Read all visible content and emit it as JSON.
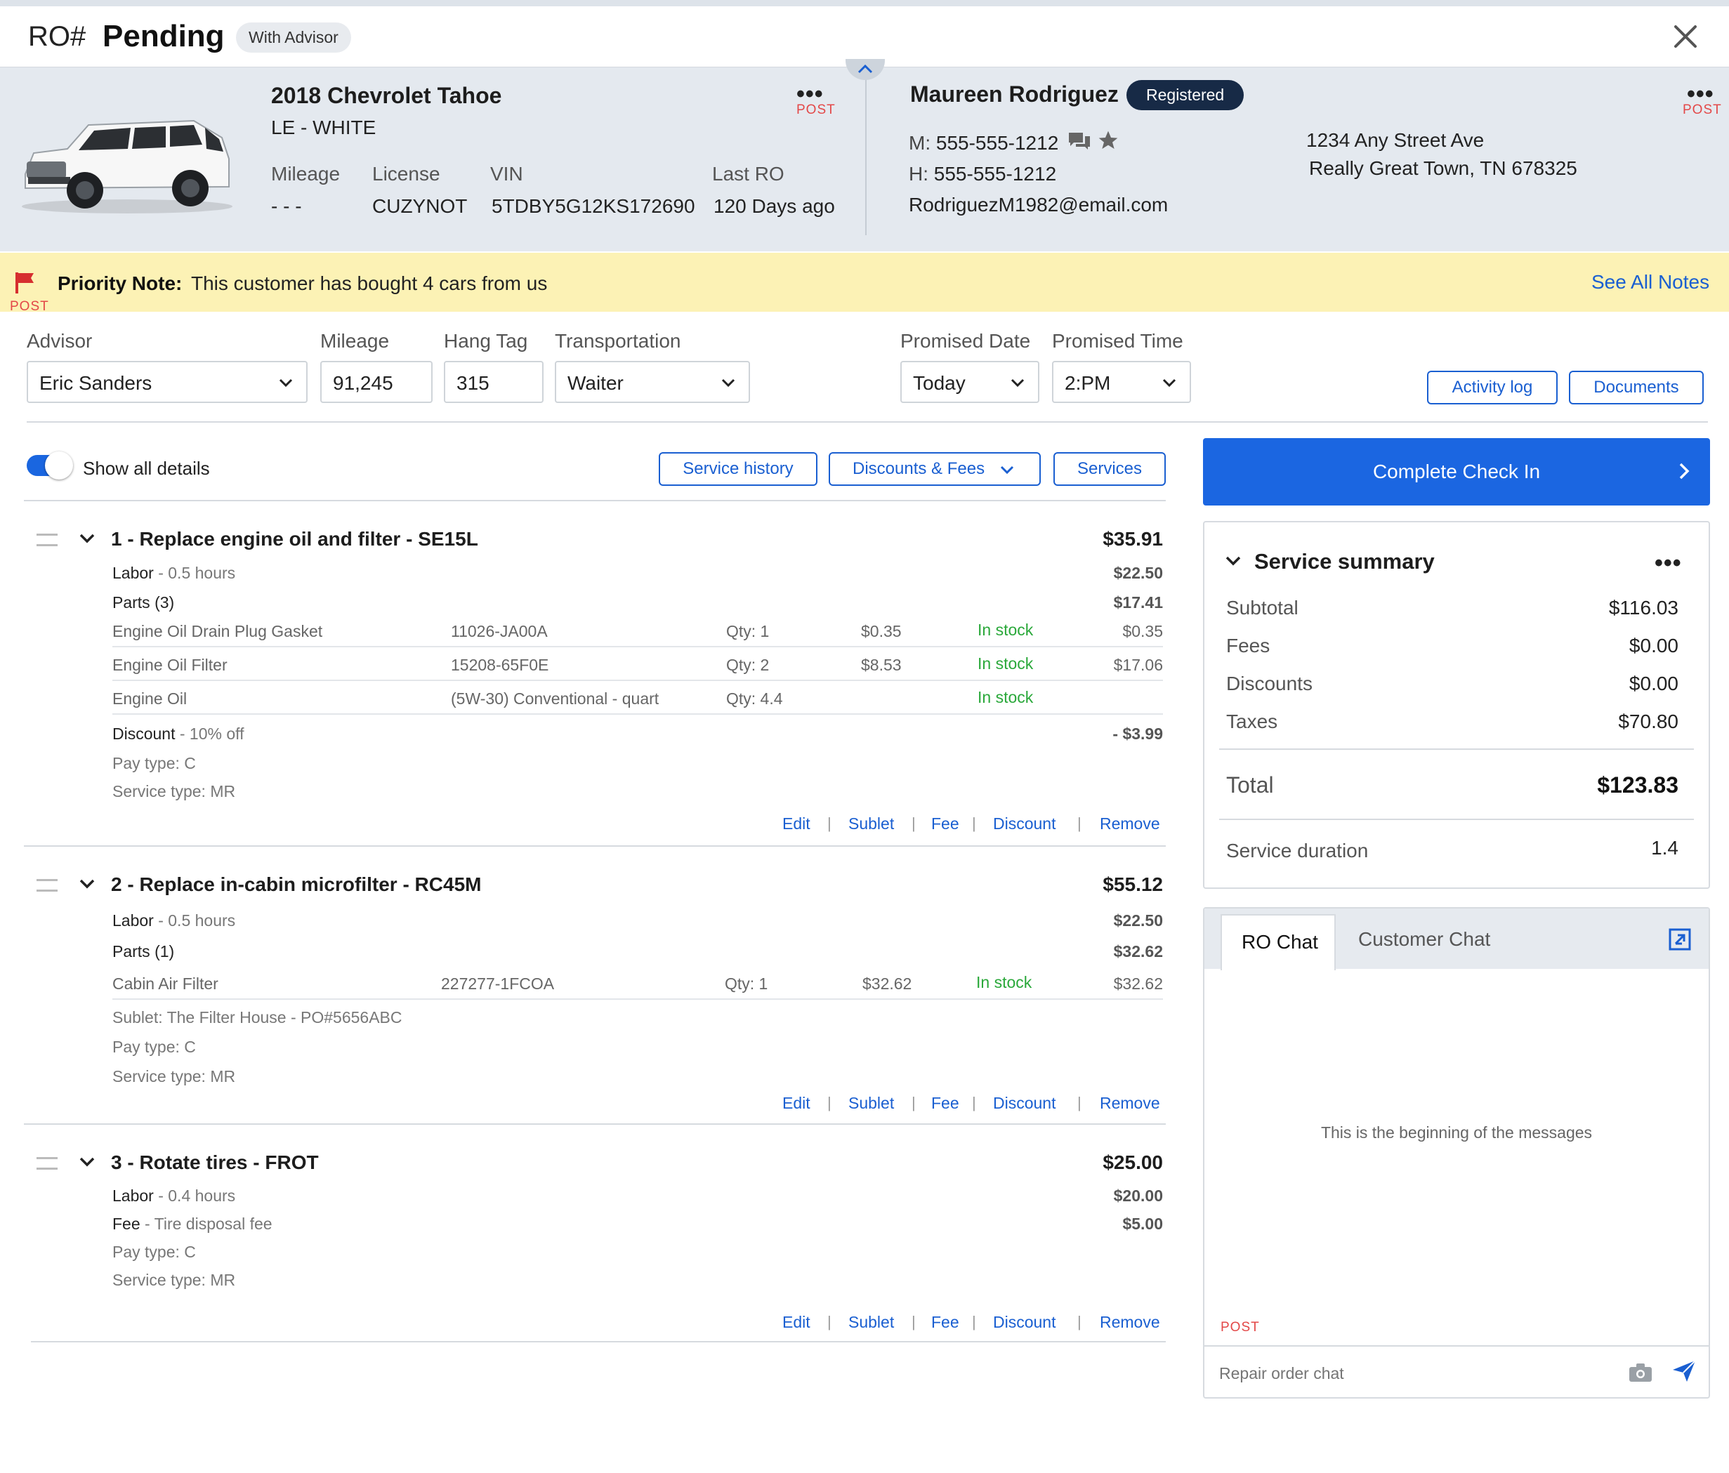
{
  "header": {
    "ro_prefix": "RO#",
    "status": "Pending",
    "state_badge": "With Advisor"
  },
  "vehicle": {
    "title": "2018 Chevrolet Tahoe",
    "trim": "LE - WHITE",
    "post": "POST",
    "mileage_label": "Mileage",
    "mileage_value": "- - -",
    "license_label": "License",
    "license_value": "CUZYNOT",
    "vin_label": "VIN",
    "vin_value": "5TDBY5G12KS172690",
    "lastro_label": "Last RO",
    "lastro_value": "120 Days ago"
  },
  "customer": {
    "name": "Maureen Rodriguez",
    "badge": "Registered",
    "post": "POST",
    "mobile_label": "M:",
    "mobile": "555-555-1212",
    "home_label": "H:",
    "home": "555-555-1212",
    "email": "RodriguezM1982@email.com",
    "address1": "1234 Any Street Ave",
    "address2": "Really Great Town, TN 678325"
  },
  "priority_note": {
    "label": "Priority Note:",
    "text": "This customer has bought 4 cars from us",
    "post": "POST",
    "see_all": "See All Notes"
  },
  "form": {
    "advisor_label": "Advisor",
    "advisor_value": "Eric Sanders",
    "mileage_label": "Mileage",
    "mileage_value": "91,245",
    "hangtag_label": "Hang Tag",
    "hangtag_value": "315",
    "transport_label": "Transportation",
    "transport_value": "Waiter",
    "promised_date_label": "Promised Date",
    "promised_date_value": "Today",
    "promised_time_label": "Promised Time",
    "promised_time_value": "2:PM",
    "activity_log": "Activity log",
    "documents": "Documents"
  },
  "toolbar": {
    "toggle_label": "Show all details",
    "toggle_on": true,
    "service_history": "Service history",
    "discounts_fees": "Discounts & Fees",
    "services": "Services"
  },
  "actions": {
    "edit": "Edit",
    "sublet": "Sublet",
    "fee": "Fee",
    "discount": "Discount",
    "remove": "Remove",
    "sep": "|"
  },
  "services": [
    {
      "title": "1 - Replace engine oil and filter - SE15L",
      "total": "$35.91",
      "labor_key": "Labor",
      "labor_val": " - 0.5 hours",
      "labor_amt": "$22.50",
      "parts_label": "Parts (3)",
      "parts_amt": "$17.41",
      "parts": [
        {
          "name": "Engine Oil Drain Plug Gasket",
          "num": "11026-JA00A",
          "qty": "Qty: 1",
          "price": "$0.35",
          "stock": "In stock",
          "total": "$0.35"
        },
        {
          "name": "Engine Oil Filter",
          "num": "15208-65F0E",
          "qty": "Qty: 2",
          "price": "$8.53",
          "stock": "In stock",
          "total": "$17.06"
        },
        {
          "name": "Engine Oil",
          "num": "(5W-30) Conventional - quart",
          "qty": "Qty: 4.4",
          "price": "",
          "stock": "In stock",
          "total": ""
        }
      ],
      "discount_key": "Discount",
      "discount_val": " - 10% off",
      "discount_amt": "- $3.99",
      "pay_type": "Pay type: C",
      "service_type": "Service type: MR"
    },
    {
      "title": "2 - Replace in-cabin microfilter - RC45M",
      "total": "$55.12",
      "labor_key": "Labor",
      "labor_val": " - 0.5 hours",
      "labor_amt": "$22.50",
      "parts_label": "Parts (1)",
      "parts_amt": "$32.62",
      "parts": [
        {
          "name": "Cabin Air Filter",
          "num": "227277-1FCOA",
          "qty": "Qty: 1",
          "price": "$32.62",
          "stock": "In stock",
          "total": "$32.62"
        }
      ],
      "sublet": "Sublet: The Filter House - PO#5656ABC",
      "pay_type": "Pay type: C",
      "service_type": "Service type: MR"
    },
    {
      "title": "3 - Rotate tires - FROT",
      "total": "$25.00",
      "labor_key": "Labor",
      "labor_val": " - 0.4 hours",
      "labor_amt": "$20.00",
      "fee_key": "Fee",
      "fee_val": " - Tire disposal fee",
      "fee_amt": "$5.00",
      "pay_type": "Pay type: C",
      "service_type": "Service type: MR"
    }
  ],
  "cta": {
    "label": "Complete Check In",
    "color": "#1b66e1"
  },
  "summary": {
    "title": "Service summary",
    "subtotal_label": "Subtotal",
    "subtotal": "$116.03",
    "fees_label": "Fees",
    "fees": "$0.00",
    "discounts_label": "Discounts",
    "discounts": "$0.00",
    "taxes_label": "Taxes",
    "taxes": "$70.80",
    "total_label": "Total",
    "total": "$123.83",
    "duration_label": "Service duration",
    "duration": "1.4"
  },
  "chat": {
    "tab_ro": "RO Chat",
    "tab_customer": "Customer Chat",
    "empty": "This is the beginning of the messages",
    "post": "POST",
    "placeholder": "Repair order chat"
  },
  "icons": [
    "close-icon",
    "more-icon",
    "chevron-up-icon",
    "chat-icon",
    "star-icon",
    "flag-icon",
    "chevron-down-icon",
    "drag-handle-icon",
    "chevron-right-icon",
    "expand-icon",
    "camera-icon",
    "send-icon",
    "vehicle-image"
  ],
  "colors": {
    "accent": "#1a5fd1",
    "note_bg": "#fcf2b5",
    "vehicle_bg": "#e4e9ef",
    "in_stock": "#2aa83a",
    "post": "#e34848",
    "registered_badge": "#172a46"
  }
}
